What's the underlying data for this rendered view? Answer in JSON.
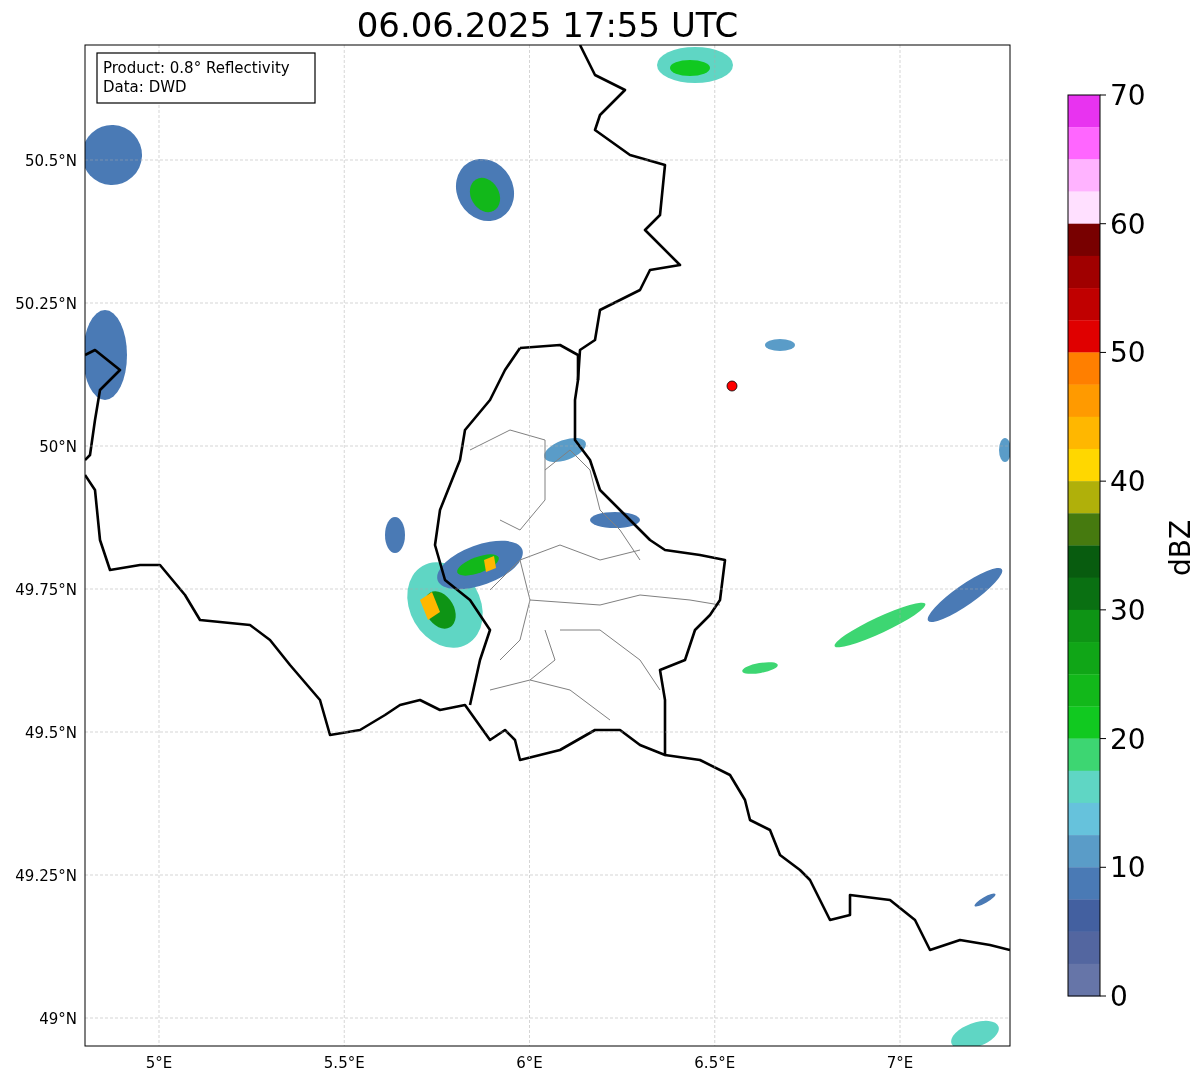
{
  "title": "06.06.2025 17:55 UTC",
  "info_box": {
    "lines": [
      "Product: 0.8° Reflectivity",
      "Data: DWD"
    ]
  },
  "map": {
    "x_ticks": [
      "5°E",
      "5.5°E",
      "6°E",
      "6.5°E",
      "7°E"
    ],
    "y_ticks": [
      "50.5°N",
      "50.25°N",
      "50°N",
      "49.75°N",
      "49.5°N",
      "49.25°N",
      "49°N"
    ]
  },
  "colorbar": {
    "label": "dBZ",
    "ticks": [
      "70",
      "60",
      "50",
      "40",
      "30",
      "20",
      "10",
      "0"
    ],
    "segments": [
      {
        "color": "#e833f0"
      },
      {
        "color": "#ff66ff"
      },
      {
        "color": "#ffb3ff"
      },
      {
        "color": "#ffe0ff"
      },
      {
        "color": "#780000"
      },
      {
        "color": "#a00000"
      },
      {
        "color": "#c00000"
      },
      {
        "color": "#e00000"
      },
      {
        "color": "#ff7f00"
      },
      {
        "color": "#ff9a00"
      },
      {
        "color": "#ffb700"
      },
      {
        "color": "#ffd700"
      },
      {
        "color": "#b0b00a"
      },
      {
        "color": "#467a0f"
      },
      {
        "color": "#085c0f"
      },
      {
        "color": "#0a7012"
      },
      {
        "color": "#0e9415"
      },
      {
        "color": "#10a617"
      },
      {
        "color": "#12b81a"
      },
      {
        "color": "#11c920"
      },
      {
        "color": "#3dd672"
      },
      {
        "color": "#5fd6c4"
      },
      {
        "color": "#66c2dc"
      },
      {
        "color": "#5a9cc8"
      },
      {
        "color": "#4a7ab5"
      },
      {
        "color": "#4360a0"
      },
      {
        "color": "#5366a0"
      },
      {
        "color": "#6675a8"
      }
    ]
  }
}
